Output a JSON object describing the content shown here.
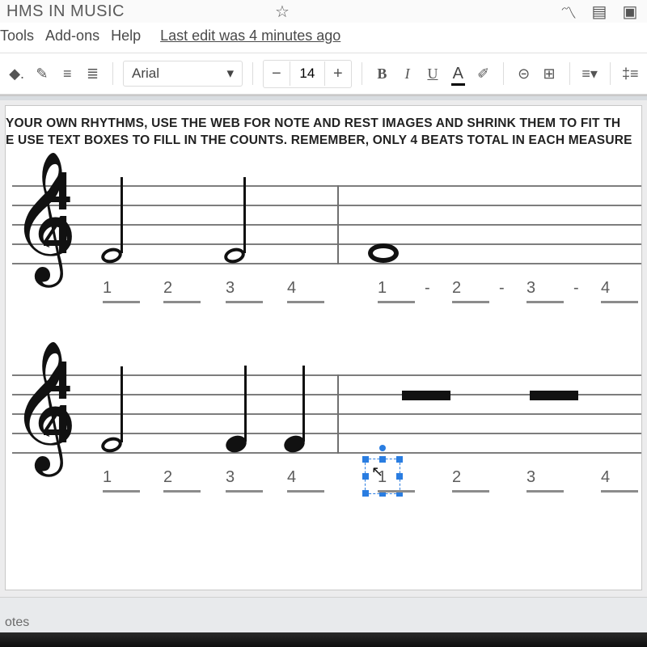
{
  "titlebar": {
    "title": "HMS IN MUSIC"
  },
  "menu": {
    "tools": "Tools",
    "addons": "Add-ons",
    "help": "Help",
    "edit_status": "Last edit was 4 minutes ago"
  },
  "toolbar": {
    "font": "Arial",
    "font_size": "14",
    "minus": "−",
    "plus": "+",
    "bold": "B",
    "italic": "I",
    "underline": "U",
    "text_color": "A"
  },
  "instructions": {
    "line1": "YOUR OWN RHYTHMS, USE THE WEB FOR NOTE AND REST IMAGES AND SHRINK THEM TO FIT TH",
    "line2": "E USE TEXT BOXES TO FILL IN THE COUNTS. REMEMBER, ONLY 4 BEATS TOTAL IN EACH MEASURE"
  },
  "staves": {
    "time_sig_top": "4",
    "time_sig_bottom": "4",
    "row1": {
      "measure1_counts": [
        "1",
        "2",
        "3",
        "4"
      ],
      "measure2_counts": [
        "1",
        "2",
        "3",
        "4"
      ],
      "measure2_dashes": [
        "-",
        "-",
        "-"
      ]
    },
    "row2": {
      "measure1_counts": [
        "1",
        "2",
        "3",
        "4"
      ],
      "measure2_counts": [
        "1",
        "2",
        "3",
        "4"
      ],
      "selected_count_index": 0
    }
  },
  "footer": {
    "notes_label": "otes"
  }
}
